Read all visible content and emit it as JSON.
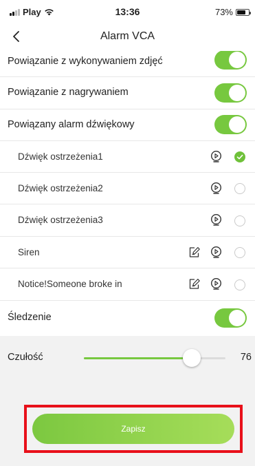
{
  "status_bar": {
    "carrier": "Play",
    "time": "13:36",
    "battery": "73%",
    "battery_level": 0.73,
    "icons": [
      "signal-icon",
      "wifi-icon",
      "battery-icon"
    ]
  },
  "header": {
    "title": "Alarm VCA",
    "back_icon": "chevron-left-icon"
  },
  "settings": {
    "photo_linkage": {
      "label": "Powiązanie z wykonywaniem zdjęć",
      "on": true
    },
    "recording_linkage": {
      "label": "Powiązanie z nagrywaniem",
      "on": true
    },
    "sound_alarm": {
      "label": "Powiązany alarm dźwiękowy",
      "on": true
    },
    "sounds": [
      {
        "label": "Dźwięk ostrzeżenia1",
        "editable": false,
        "selected": true
      },
      {
        "label": "Dźwięk ostrzeżenia2",
        "editable": false,
        "selected": false
      },
      {
        "label": "Dźwięk ostrzeżenia3",
        "editable": false,
        "selected": false
      },
      {
        "label": "Siren",
        "editable": true,
        "selected": false
      },
      {
        "label": "Notice!Someone broke in",
        "editable": true,
        "selected": false
      }
    ],
    "tracking": {
      "label": "Śledzenie",
      "on": true
    }
  },
  "sensitivity": {
    "label": "Czułość",
    "value": "76",
    "fraction": 0.76
  },
  "save_button": {
    "label": "Zapisz"
  },
  "colors": {
    "accent": "#77c83f",
    "highlight": "#e8101a",
    "background": "#f2f2f2"
  }
}
